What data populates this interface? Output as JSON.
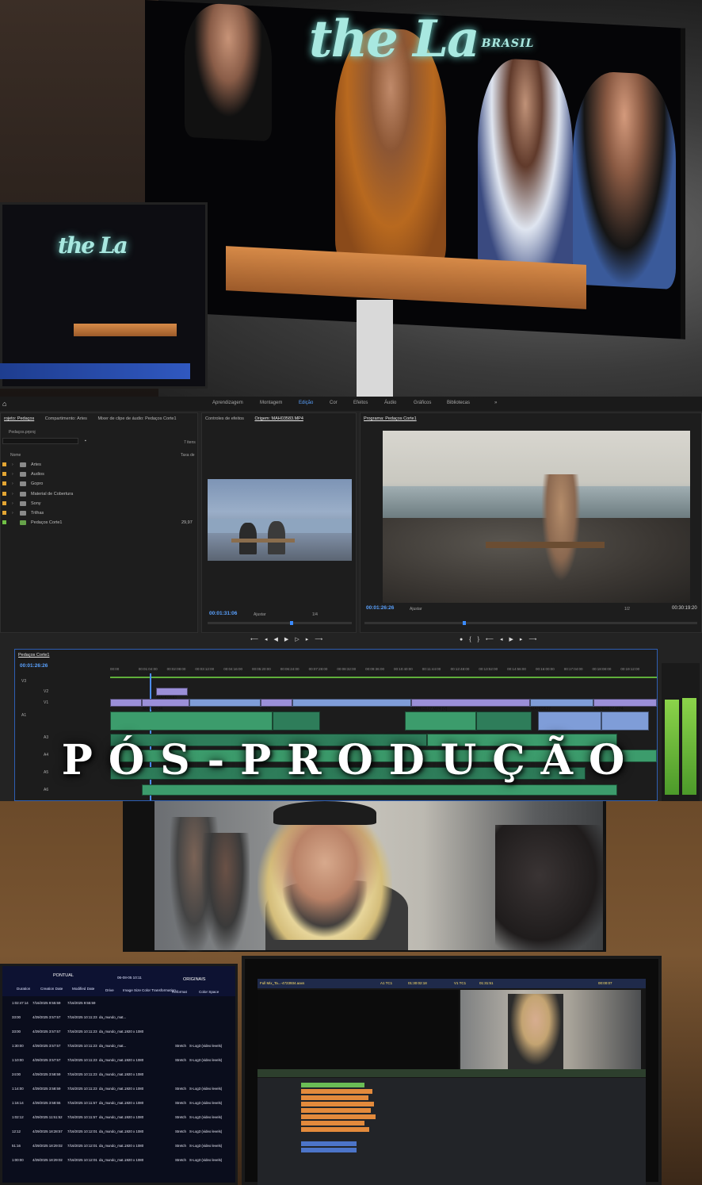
{
  "title_overlay": "PÓS-PRODUÇÃO",
  "tv_logo": {
    "text": "the La",
    "sub": "BRASIL",
    "color": "#a8e8e0"
  },
  "premiere": {
    "workspaces": [
      "Aprendizagem",
      "Montagem",
      "Edição",
      "Cor",
      "Efeitos",
      "Áudio",
      "Gráficos",
      "Bibliotecas"
    ],
    "active_workspace": "Edição",
    "more_icon": "»",
    "project_panel": {
      "tabs": [
        "rojeto: Pedaços",
        "Compartimento: Artes",
        "Mixer de clipe de áudio: Pedaços Corte1"
      ],
      "project_file": "Pedaços.prproj",
      "item_count": "7 itens",
      "col_name": "Nome",
      "col_rate": "Taxa de",
      "items": [
        {
          "label": "Artes",
          "type": "folder"
        },
        {
          "label": "Audios",
          "type": "folder"
        },
        {
          "label": "Gopro",
          "type": "folder"
        },
        {
          "label": "Material de Cobertura",
          "type": "folder"
        },
        {
          "label": "Sony",
          "type": "folder"
        },
        {
          "label": "Trilhas",
          "type": "folder"
        },
        {
          "label": "Pedaços Corte1",
          "type": "sequence",
          "rate": "29,97"
        }
      ]
    },
    "source_panel": {
      "tabs": [
        "Controles de efeitos",
        "Origem: MAH03583.MP4"
      ],
      "timecode": "00:01:31:06",
      "fit": "Ajustar",
      "page": "1/4"
    },
    "program_panel": {
      "tab": "Programa: Pedaços Corte1",
      "timecode": "00:01:26:26",
      "fit": "Ajustar",
      "page": "1/2",
      "duration": "00:30:19:20"
    },
    "timeline": {
      "sequence_tab": "Pedaços Corte1",
      "timecode": "00:01:26:26",
      "ruler": [
        "00:00",
        "00:01:04:00",
        "00:02:08:00",
        "00:03:12:00",
        "00:04:16:00",
        "00:05:20:00",
        "00:06:24:00",
        "00:07:28:00",
        "00:08:32:00",
        "00:09:36:00",
        "00:10:40:00",
        "00:11:44:00",
        "00:12:48:00",
        "00:13:52:00",
        "00:14:56:00",
        "00:16:00:00",
        "00:17:04:00",
        "00:18:08:00",
        "00:19:12:00",
        "00:20"
      ],
      "tracks_video": [
        "V3",
        "V2",
        "V1"
      ],
      "tracks_audio": [
        "A1",
        "A2",
        "A3",
        "A4",
        "A5",
        "A6"
      ],
      "clip_labels": [
        "MAH03583",
        "MAH03044",
        "MAH",
        "MAH03527.MP4 [V]",
        "MAH03527",
        "MAH03527.MP4"
      ]
    }
  },
  "bottom": {
    "left_monitor": {
      "headers": [
        "PONTUAL",
        "ORIGINAIS"
      ],
      "col_labels": [
        "Duration",
        "Creation Date",
        "Modified Date",
        "Drive",
        "Image Size",
        "Color Transformation",
        "Reformat",
        "Color Space"
      ],
      "top_date": "06-08-05 10:11",
      "rows": [
        {
          "dur": "1:02:47:14",
          "created": "7/16/2025 9:55:59",
          "modified": "7/16/2025 9:55:59",
          "file": "",
          "size": "",
          "reformat": "",
          "space": ""
        },
        {
          "dur": "33:00",
          "created": "4/29/2025 3:57:57",
          "modified": "7/16/2025 10:11:23",
          "file": "da_mundo_mat...",
          "size": "",
          "reformat": "",
          "space": ""
        },
        {
          "dur": "33:00",
          "created": "4/29/2025 3:57:57",
          "modified": "7/16/2025 10:11:23",
          "file": "da_mundo_mat...",
          "size": "1920 x 1080",
          "reformat": "",
          "space": ""
        },
        {
          "dur": "1:30:00",
          "created": "4/29/2025 3:57:57",
          "modified": "7/16/2025 10:11:23",
          "file": "da_mundo_mat...",
          "size": "",
          "reformat": "Stretch",
          "space": "S-Log3 (video levels)"
        },
        {
          "dur": "1:10:00",
          "created": "4/29/2025 3:57:57",
          "modified": "7/16/2025 10:11:23",
          "file": "da_mundo_mat...",
          "size": "1920 x 1080",
          "reformat": "Stretch",
          "space": "S-Log3 (video levels)"
        },
        {
          "dur": "24:00",
          "created": "4/29/2025 3:58:59",
          "modified": "7/16/2025 10:11:23",
          "file": "da_mundo_mat...",
          "size": "1920 x 1080",
          "reformat": "",
          "space": ""
        },
        {
          "dur": "1:14:00",
          "created": "4/29/2025 3:58:59",
          "modified": "7/16/2025 10:11:23",
          "file": "da_mundo_mat...",
          "size": "1920 x 1080",
          "reformat": "Stretch",
          "space": "S-Log3 (video levels)"
        },
        {
          "dur": "1:16:14",
          "created": "4/29/2025 3:58:55",
          "modified": "7/16/2025 10:11:57",
          "file": "da_mundo_mat...",
          "size": "1920 x 1080",
          "reformat": "Stretch",
          "space": "S-Log3 (video levels)"
        },
        {
          "dur": "1:02:12",
          "created": "4/29/2025 11:51:52",
          "modified": "7/16/2025 10:11:57",
          "file": "da_mundo_mat...",
          "size": "1920 x 1080",
          "reformat": "Stretch",
          "space": "S-Log3 (video levels)"
        },
        {
          "dur": "12:12",
          "created": "4/29/2025 18:28:57",
          "modified": "7/16/2025 10:12:01",
          "file": "da_mundo_mat...",
          "size": "1920 x 1080",
          "reformat": "Stretch",
          "space": "S-Log3 (video levels)"
        },
        {
          "dur": "51:16",
          "created": "4/29/2025 18:29:02",
          "modified": "7/16/2025 10:12:01",
          "file": "da_mundo_mat...",
          "size": "1920 x 1080",
          "reformat": "Stretch",
          "space": "S-Log3 (video levels)"
        },
        {
          "dur": "1:00:00",
          "created": "4/29/2025 18:29:02",
          "modified": "7/16/2025 10:12:01",
          "file": "da_mundo_mat...",
          "size": "1920 x 1080",
          "reformat": "Stretch",
          "space": "S-Log3 (video levels)"
        }
      ]
    },
    "right_monitor": {
      "toolbar": "Full Mix_Ta...-4723934.aaxs",
      "tc_a1": "A1 TC1",
      "tc_v1": "V1 TC1",
      "tc_left": "01:30:02:18",
      "tc_mid": "01:31:51",
      "tc_right": "00:00:07"
    }
  }
}
